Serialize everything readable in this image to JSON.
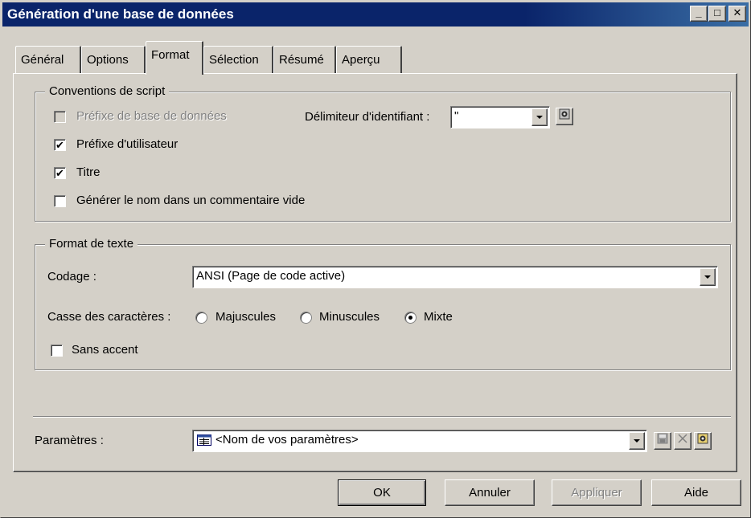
{
  "window": {
    "title": "Génération d'une base de données",
    "controls": {
      "minimize": "_",
      "maximize": "□",
      "close": "✕"
    }
  },
  "tabs": [
    {
      "label": "Général",
      "active": false
    },
    {
      "label": "Options",
      "active": false
    },
    {
      "label": "Format",
      "active": true
    },
    {
      "label": "Sélection",
      "active": false
    },
    {
      "label": "Résumé",
      "active": false
    },
    {
      "label": "Aperçu",
      "active": false
    }
  ],
  "script_conventions": {
    "legend": "Conventions de script",
    "db_prefix": {
      "label": "Préfixe de base de données",
      "checked": false,
      "enabled": false
    },
    "user_prefix": {
      "label": "Préfixe d'utilisateur",
      "checked": true
    },
    "title": {
      "label": "Titre",
      "checked": true
    },
    "empty_comment": {
      "label": "Générer le nom dans un commentaire vide",
      "checked": false
    },
    "identifier_delimiter": {
      "label": "Délimiteur d'identifiant :",
      "value": "\""
    }
  },
  "text_format": {
    "legend": "Format de texte",
    "encoding": {
      "label": "Codage :",
      "value": "ANSI (Page de code active)"
    },
    "case": {
      "label": "Casse des caractères :",
      "options": [
        {
          "label": "Majuscules",
          "selected": false
        },
        {
          "label": "Minuscules",
          "selected": false
        },
        {
          "label": "Mixte",
          "selected": true
        }
      ]
    },
    "no_accent": {
      "label": "Sans accent",
      "checked": false
    }
  },
  "parameters": {
    "label": "Paramètres :",
    "value": "<Nom de vos paramètres>"
  },
  "buttons": {
    "ok": "OK",
    "cancel": "Annuler",
    "apply": "Appliquer",
    "help": "Aide"
  },
  "icons": {
    "delimiter_properties": "properties-icon",
    "params_list": "list-icon",
    "params_save": "save-icon",
    "params_delete": "delete-icon",
    "params_properties": "properties-icon"
  }
}
